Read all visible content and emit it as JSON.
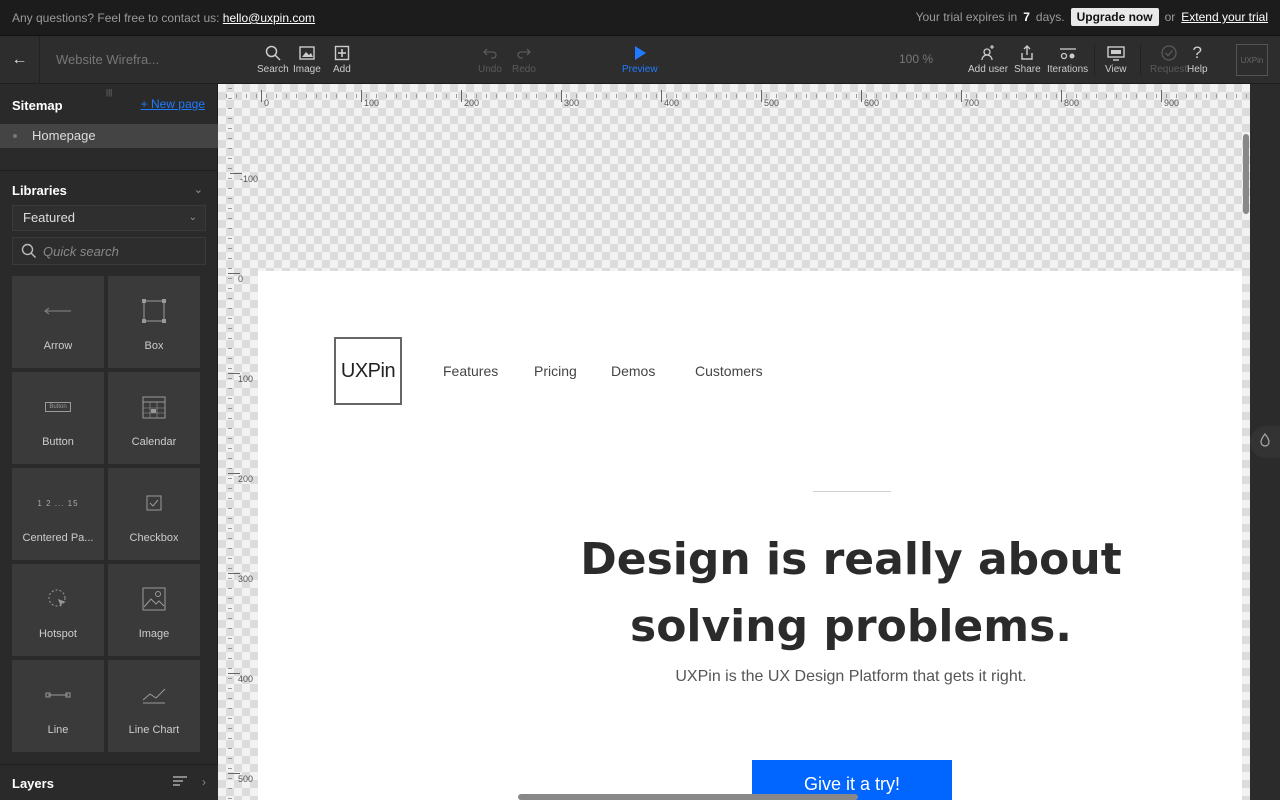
{
  "notice": {
    "question": "Any questions? Feel free to contact us:",
    "email": "hello@uxpin.com",
    "trial_prefix": "Your trial expires in",
    "trial_days": "7",
    "trial_suffix": "days.",
    "upgrade_label": "Upgrade now",
    "or": "or",
    "extend_label": "Extend your trial"
  },
  "toolbar": {
    "project_name": "Website Wirefra...",
    "search": "Search",
    "image": "Image",
    "add": "Add",
    "undo": "Undo",
    "redo": "Redo",
    "preview": "Preview",
    "zoom": "100 %",
    "add_user": "Add user",
    "share": "Share",
    "iterations": "Iterations",
    "view": "View",
    "approval": "Request",
    "help": "Help",
    "brand": "UXPin"
  },
  "sidebar": {
    "sitemap_title": "Sitemap",
    "new_page": "+ New page",
    "pages": [
      "Homepage"
    ],
    "libraries_title": "Libraries",
    "library_selected": "Featured",
    "search_placeholder": "Quick search",
    "tiles": [
      {
        "label": "Arrow",
        "icon": "arrow-icon"
      },
      {
        "label": "Box",
        "icon": "box-icon"
      },
      {
        "label": "Button",
        "icon": "button-icon"
      },
      {
        "label": "Calendar",
        "icon": "calendar-icon"
      },
      {
        "label": "Centered Pa...",
        "icon": "pagination-icon"
      },
      {
        "label": "Checkbox",
        "icon": "checkbox-icon"
      },
      {
        "label": "Hotspot",
        "icon": "hotspot-icon"
      },
      {
        "label": "Image",
        "icon": "image-icon"
      },
      {
        "label": "Line",
        "icon": "line-icon"
      },
      {
        "label": "Line Chart",
        "icon": "line-chart-icon"
      }
    ],
    "pagination_sample": "1 2 ... 15",
    "button_sample": "Button",
    "layers_title": "Layers"
  },
  "rulers": {
    "h": [
      "0",
      "100",
      "200",
      "300",
      "400",
      "500",
      "600",
      "700",
      "800",
      "900"
    ],
    "v_top": "-100",
    "v": [
      "0",
      "100",
      "200",
      "300",
      "400",
      "500"
    ]
  },
  "artboard": {
    "logo": "UXPin",
    "nav": [
      "Features",
      "Pricing",
      "Demos",
      "Customers"
    ],
    "headline_1": "Design is really about",
    "headline_2": "solving problems.",
    "subheadline": "UXPin is the UX Design Platform that gets it right.",
    "cta": "Give it a try!"
  },
  "colors": {
    "accent": "#1f7bff",
    "cta": "#0066ff",
    "toolbar_bg": "#2d2d2d",
    "notice_bg": "#1c1c1c"
  }
}
